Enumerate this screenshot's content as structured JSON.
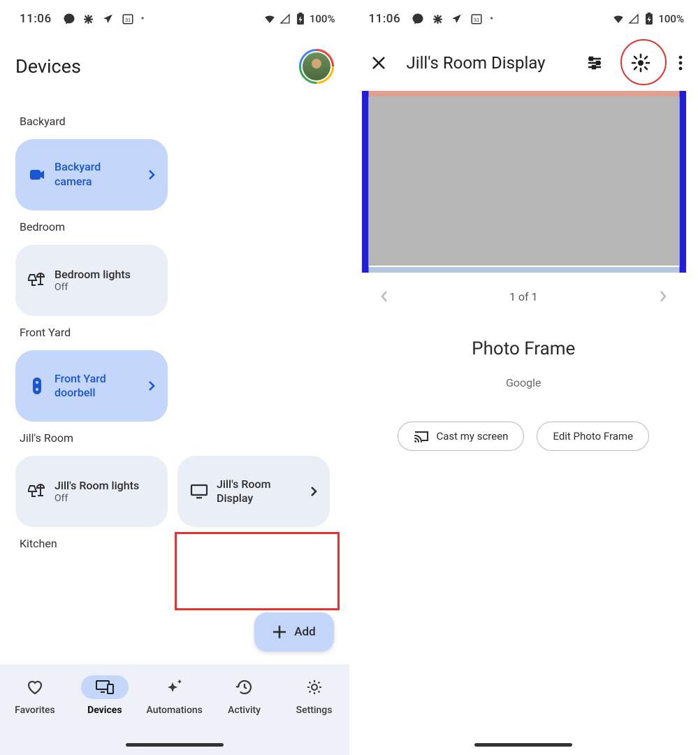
{
  "status": {
    "time": "11:06",
    "battery": "100%"
  },
  "left": {
    "title": "Devices",
    "sections": {
      "backyard": {
        "label": "Backyard",
        "camera_label": "Backyard camera"
      },
      "bedroom": {
        "label": "Bedroom",
        "lights_label": "Bedroom lights",
        "lights_state": "Off"
      },
      "frontyard": {
        "label": "Front Yard",
        "doorbell_label": "Front Yard doorbell"
      },
      "jillsroom": {
        "label": "Jill's Room",
        "lights_label": "Jill's Room lights",
        "lights_state": "Off",
        "display_label": "Jill's Room Display"
      },
      "kitchen": {
        "label": "Kitchen"
      }
    },
    "fab_label": "Add",
    "nav": {
      "favorites": "Favorites",
      "devices": "Devices",
      "automations": "Automations",
      "activity": "Activity",
      "settings": "Settings"
    }
  },
  "right": {
    "title": "Jill's Room Display",
    "pager": "1 of 1",
    "detail_title": "Photo Frame",
    "detail_sub": "Google",
    "cast_label": "Cast my screen",
    "edit_label": "Edit Photo Frame"
  }
}
